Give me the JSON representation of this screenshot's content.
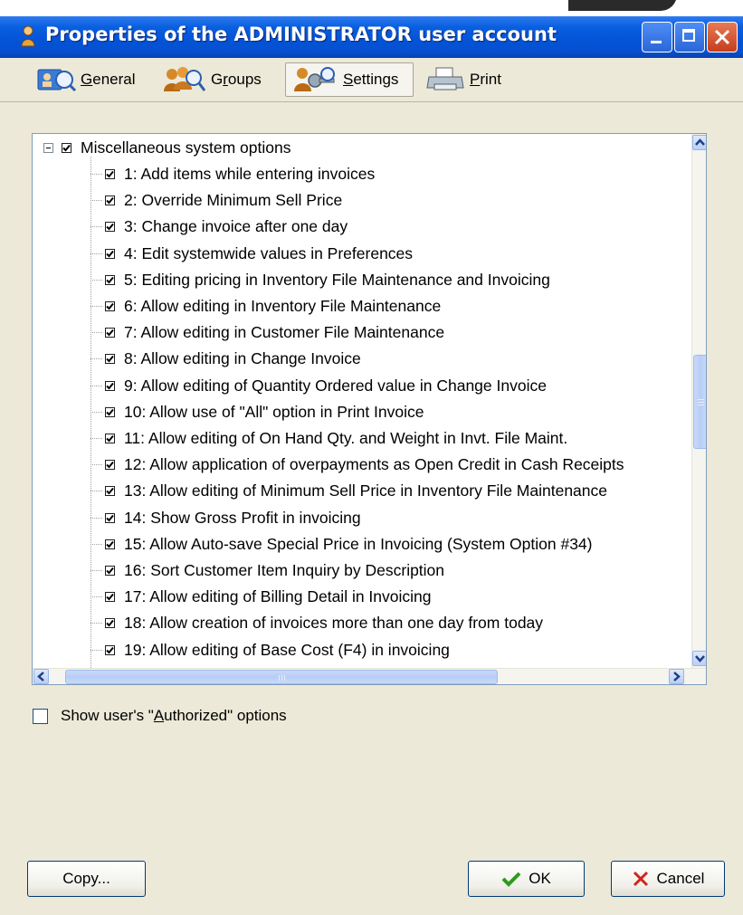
{
  "window": {
    "title": "Properties of the ADMINISTRATOR user account"
  },
  "toolbar": {
    "tabs": [
      {
        "label": "General",
        "icon": "user-card-icon"
      },
      {
        "label": "Groups",
        "icon": "user-group-icon"
      },
      {
        "label": "Settings",
        "icon": "user-key-icon",
        "active": true
      },
      {
        "label": "Print",
        "icon": "printer-icon"
      }
    ]
  },
  "tree": {
    "root": {
      "label": "Miscellaneous system options",
      "checked": true,
      "expanded": true
    },
    "items": [
      {
        "label": "1: Add items while entering invoices",
        "checked": true
      },
      {
        "label": "2: Override Minimum Sell Price",
        "checked": true
      },
      {
        "label": "3: Change invoice after one day",
        "checked": true
      },
      {
        "label": "4: Edit systemwide values in Preferences",
        "checked": true
      },
      {
        "label": "5: Editing pricing in Inventory File Maintenance and Invoicing",
        "checked": true
      },
      {
        "label": "6: Allow editing in Inventory File Maintenance",
        "checked": true
      },
      {
        "label": "7: Allow editing in Customer File Maintenance",
        "checked": true
      },
      {
        "label": "8: Allow editing in Change Invoice",
        "checked": true
      },
      {
        "label": "9: Allow editing of Quantity Ordered value in Change Invoice",
        "checked": true
      },
      {
        "label": "10: Allow use of \"All\" option in Print Invoice",
        "checked": true
      },
      {
        "label": "11: Allow editing of On Hand Qty. and Weight in Invt. File Maint.",
        "checked": true
      },
      {
        "label": "12: Allow application of overpayments as Open Credit in Cash Receipts",
        "checked": true
      },
      {
        "label": "13: Allow editing of Minimum Sell Price in Inventory File Maintenance",
        "checked": true
      },
      {
        "label": "14: Show Gross Profit in invoicing",
        "checked": true
      },
      {
        "label": "15: Allow Auto-save Special Price in Invoicing (System Option #34)",
        "checked": true
      },
      {
        "label": "16: Sort Customer Item Inquiry by Description",
        "checked": true
      },
      {
        "label": "17: Allow editing of Billing Detail in Invoicing",
        "checked": true
      },
      {
        "label": "18: Allow creation of invoices more than one day from today",
        "checked": true
      },
      {
        "label": "19: Allow editing of Base Cost (F4) in invoicing",
        "checked": true
      }
    ]
  },
  "options": {
    "show_authorized": {
      "label_pre": "Show user's \"",
      "label_accel": "A",
      "label_post": "uthorized\" options",
      "checked": false
    }
  },
  "buttons": {
    "copy": "Copy...",
    "ok": "OK",
    "cancel": "Cancel"
  }
}
